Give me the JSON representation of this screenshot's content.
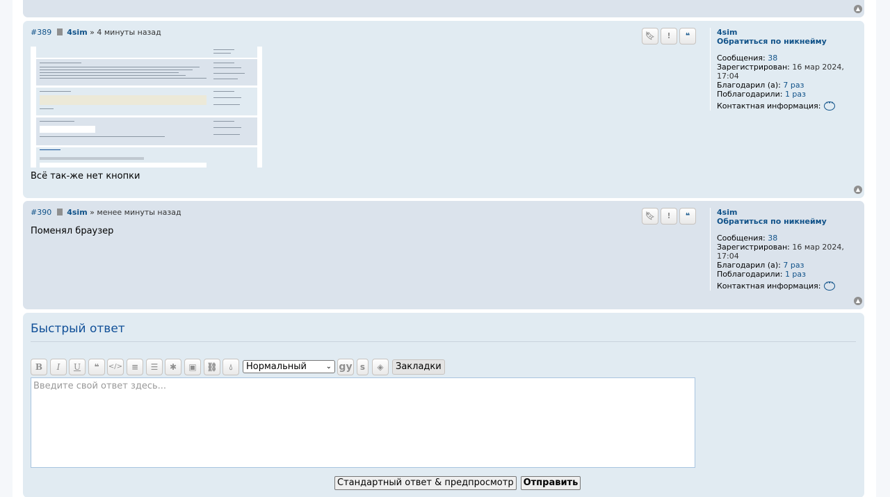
{
  "posts": [
    {
      "number": "#389",
      "author": "4sim",
      "separator": "»",
      "time": "4 минуты назад",
      "body": "Всё так-же нет кнопки",
      "has_attachment": true
    },
    {
      "number": "#390",
      "author": "4sim",
      "separator": "»",
      "time": "менее минуты назад",
      "body": "Поменял браузер",
      "has_attachment": false
    }
  ],
  "profile": {
    "username": "4sim",
    "contact_by_nick": "Обратиться по никнейму",
    "posts_label": "Сообщения:",
    "posts_value": "38",
    "registered_label": "Зарегистрирован:",
    "registered_value": "16 мар 2024, 17:04",
    "thanked_label": "Благодарил (а):",
    "thanked_value": "7 раз",
    "was_thanked_label": "Поблагодарили:",
    "was_thanked_value": "1 раз",
    "contact_label": "Контактная информация:"
  },
  "quick_reply": {
    "title": "Быстрый ответ",
    "font_size_selected": "Нормальный",
    "bookmarks_button": "Закладки",
    "gy_button": "gy",
    "s_button": "s",
    "placeholder": "Введите свой ответ здесь...",
    "full_editor_button": "Стандартный ответ & предпросмотр",
    "submit_button": "Отправить"
  },
  "icons": {
    "post_buttons": [
      "bookmark-icon",
      "report-icon",
      "quote-icon"
    ],
    "toolbar": [
      "bold-icon",
      "italic-icon",
      "underline-icon",
      "quote-icon",
      "code-icon",
      "list-icon",
      "numbered-list-icon",
      "list-item-icon",
      "image-icon",
      "link-icon",
      "color-icon"
    ]
  },
  "colors": {
    "link": "#105289",
    "post_bg": "#e1ebf2",
    "post_bg_alt": "#dbe3ec",
    "title": "#115098"
  }
}
